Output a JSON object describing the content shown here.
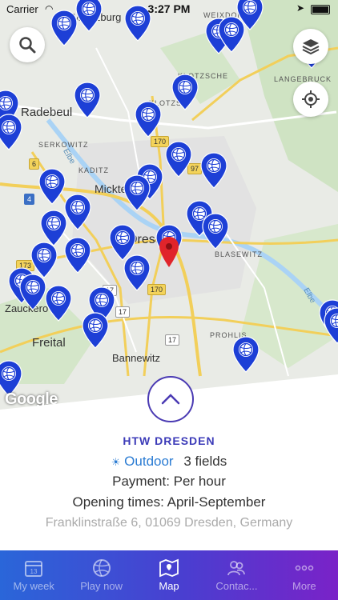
{
  "status_bar": {
    "carrier": "Carrier",
    "time": "3:27 PM"
  },
  "map": {
    "places": [
      {
        "id": "radebeul",
        "label": "Radebeul"
      },
      {
        "id": "freital",
        "label": "Freital"
      },
      {
        "id": "bannewitz",
        "label": "Bannewitz"
      },
      {
        "id": "mickten",
        "label": "Mickte"
      },
      {
        "id": "dresden",
        "label": "Dresden"
      },
      {
        "id": "zauckerode",
        "label": "Zauckero"
      },
      {
        "id": "moritzburg",
        "label": "Moritzburg"
      },
      {
        "id": "klotzsche",
        "label": "KLOTZSCHE"
      },
      {
        "id": "klotzsche2",
        "label": "KLOTZSC"
      },
      {
        "id": "langebrueck",
        "label": "LANGEBRUCK"
      },
      {
        "id": "weixdorf",
        "label": "WEIXDORF"
      },
      {
        "id": "serkowitz",
        "label": "SERKOWITZ"
      },
      {
        "id": "kaditz",
        "label": "KADITZ"
      },
      {
        "id": "blasewitz",
        "label": "BLASEWITZ"
      },
      {
        "id": "prohlis",
        "label": "PROHLIS"
      },
      {
        "id": "elbe",
        "label": "Elbe"
      },
      {
        "id": "elbe2",
        "label": "Elbe"
      }
    ],
    "road_badges": [
      "170",
      "170",
      "97",
      "6",
      "4",
      "173",
      "17",
      "17",
      "17"
    ],
    "attribution": "Google"
  },
  "court": {
    "name": "HTW DRESDEN",
    "type": "Outdoor",
    "fields": "3 fields",
    "payment": "Payment: Per hour",
    "opening": "Opening times: April-September",
    "address": "Franklinstraße 6, 01069 Dresden, Germany"
  },
  "tabs": [
    {
      "id": "my-week",
      "label": "My week",
      "icon": "calendar-icon",
      "active": false
    },
    {
      "id": "play-now",
      "label": "Play now",
      "icon": "volleyball-icon",
      "active": false
    },
    {
      "id": "map",
      "label": "Map",
      "icon": "map-icon",
      "active": true
    },
    {
      "id": "contacts",
      "label": "Contac...",
      "icon": "people-icon",
      "active": false
    },
    {
      "id": "more",
      "label": "More",
      "icon": "more-dots-icon",
      "active": false
    }
  ],
  "colors": {
    "accent": "#3c3bb8",
    "pin": "#1d3fd6",
    "outdoor": "#2b7cd3",
    "tab_start": "#2a66d9",
    "tab_end": "#7a22c8",
    "selected_pin": "#e0242b"
  }
}
